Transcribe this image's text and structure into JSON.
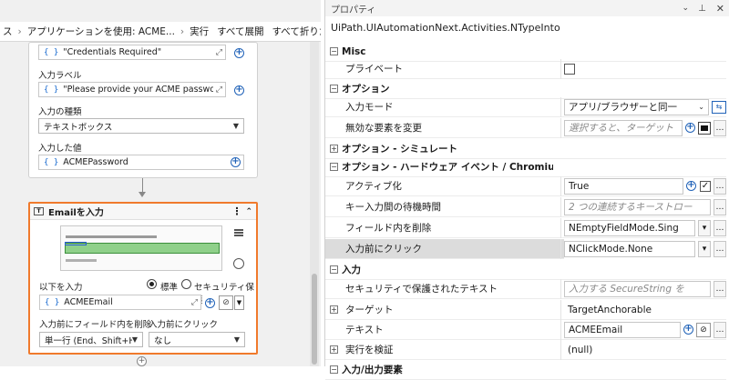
{
  "breadcrumb": {
    "items": [
      "ス",
      "アプリケーションを使用: ACME...",
      "実行",
      "すべて展開",
      "すべて折りたたむ"
    ]
  },
  "login_card": {
    "field1_value": "\"Credentials Required\"",
    "input_label_title": "入力ラベル",
    "input_label_value": "\"Please provide your ACME password.\"",
    "input_type_title": "入力の種類",
    "input_type_value": "テキストボックス",
    "input_value_title": "入力した値",
    "input_value_value": "ACMEPassword"
  },
  "email_activity": {
    "title": "Emailを入力",
    "input_with_label": "以下を入力",
    "radio_standard": "標準",
    "radio_secure": "セキュリティ保護",
    "input_value": "ACMEEmail",
    "clear_field_label": "入力前にフィールド内を削除",
    "clear_field_value": "単一行 (End、Shift+Hom",
    "click_before_label": "入力前にクリック",
    "click_before_value": "なし"
  },
  "properties": {
    "title": "プロパティ",
    "type_name": "UiPath.UIAutomationNext.Activities.NTypeInto",
    "rows": {
      "misc": "Misc",
      "private": "プライベート",
      "options": "オプション",
      "input_mode": "入力モード",
      "input_mode_value": "アプリ/ブラウザーと同一",
      "change_disabled": "無効な要素を変更",
      "change_disabled_ph": "選択すると、ターゲット",
      "simulate": "オプション - シミュレート",
      "hardware": "オプション - ハードウェア イベント / Chromium API",
      "activate": "アクティブ化",
      "activate_value": "True",
      "key_delay": "キー入力間の待機時間",
      "key_delay_ph": "2 つの連続するキーストロー",
      "empty_field": "フィールド内を削除",
      "empty_field_value": "NEmptyFieldMode.Sing",
      "click_before": "入力前にクリック",
      "click_before_value": "NClickMode.None",
      "input": "入力",
      "secure_text": "セキュリティで保護されたテキスト",
      "secure_text_ph": "入力する SecureString を",
      "target": "ターゲット",
      "target_value": "TargetAnchorable",
      "text": "テキスト",
      "text_value": "ACMEEmail",
      "verify": "実行を検証",
      "verify_value": "(null)",
      "inout": "入力/出力要素"
    }
  },
  "colors": {
    "accent_orange": "#f07a2c",
    "link_blue": "#2062b8",
    "selected_row": "#dcdcdc"
  }
}
